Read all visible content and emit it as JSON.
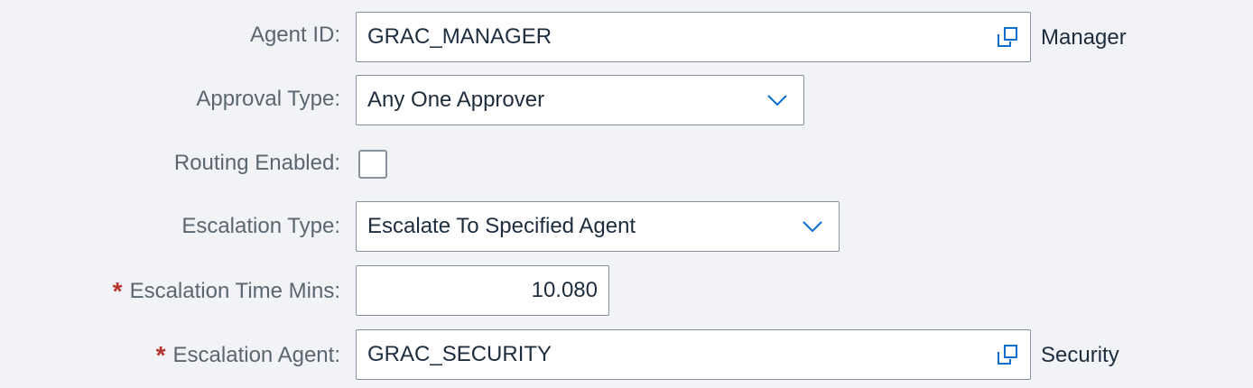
{
  "form": {
    "agent_id": {
      "label": "Agent ID:",
      "value": "GRAC_MANAGER",
      "description": "Manager",
      "icon": "value-help-icon"
    },
    "approval_type": {
      "label": "Approval Type:",
      "value": "Any One Approver",
      "icon": "chevron-down-icon"
    },
    "routing_enabled": {
      "label": "Routing Enabled:",
      "checked": false
    },
    "escalation_type": {
      "label": "Escalation Type:",
      "value": "Escalate To Specified Agent",
      "icon": "chevron-down-icon"
    },
    "escalation_time": {
      "required_marker": "*",
      "label": "Escalation Time Mins:",
      "value": "10.080"
    },
    "escalation_agent": {
      "required_marker": "*",
      "label": "Escalation Agent:",
      "value": "GRAC_SECURITY",
      "description": "Security",
      "icon": "value-help-icon"
    }
  },
  "colors": {
    "background": "#f1f3f7",
    "label_text": "#5b6670",
    "value_text": "#1d2d3e",
    "field_border": "#89919a",
    "required_marker": "#b5332a",
    "icon": "#0a6ed1"
  }
}
